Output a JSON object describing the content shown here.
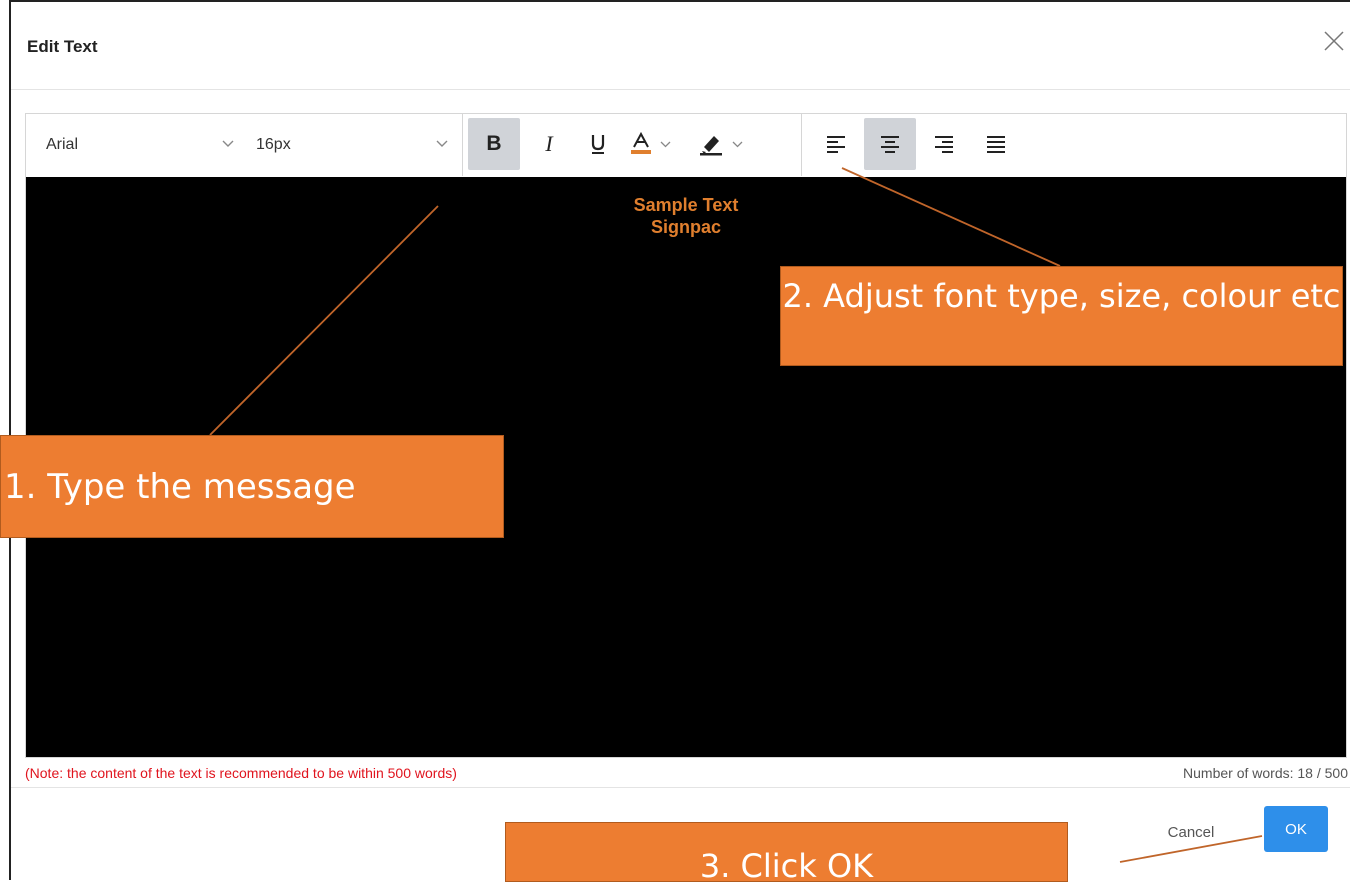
{
  "dialog": {
    "title": "Edit Text",
    "close_icon": "close-icon"
  },
  "toolbar": {
    "font_family": "Arial",
    "font_size": "16px",
    "buttons": [
      {
        "name": "bold",
        "icon": "bold-icon",
        "active": true
      },
      {
        "name": "italic",
        "icon": "italic-icon",
        "active": false
      },
      {
        "name": "underline",
        "icon": "underline-icon",
        "active": false
      },
      {
        "name": "font-color",
        "icon": "font-color-icon",
        "color": "#e07f2e"
      },
      {
        "name": "highlight",
        "icon": "highlighter-icon"
      },
      {
        "name": "align-left",
        "icon": "align-left-icon",
        "active": false
      },
      {
        "name": "align-center",
        "icon": "align-center-icon",
        "active": true
      },
      {
        "name": "align-right",
        "icon": "align-right-icon",
        "active": false
      },
      {
        "name": "align-justify",
        "icon": "align-justify-icon",
        "active": false
      }
    ]
  },
  "editor": {
    "lines": [
      "Sample Text",
      "Signpac"
    ],
    "background": "#000000",
    "text_color": "#e07f2e"
  },
  "note": "(Note: the content of the text is recommended to be within 500 words)",
  "word_count": "Number of words: 18 / 500",
  "footer": {
    "cancel_label": "Cancel",
    "ok_label": "OK"
  },
  "callouts": {
    "step1": "1. Type the message",
    "step2": "2. Adjust font type, size, colour etc",
    "step3": "3. Click OK"
  },
  "colors": {
    "callout": "#ed7d31",
    "accent": "#2e8fea",
    "note": "#e0141e"
  }
}
